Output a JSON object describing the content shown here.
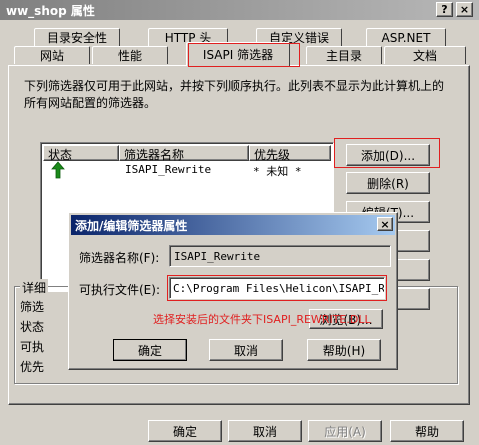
{
  "window": {
    "title": "ww_shop 属性",
    "help_glyph": "?",
    "close_glyph": "×"
  },
  "tabs_back": [
    {
      "label": "目录安全性"
    },
    {
      "label": "HTTP 头"
    },
    {
      "label": "自定义错误"
    },
    {
      "label": "ASP.NET"
    }
  ],
  "tabs_front": [
    {
      "label": "网站"
    },
    {
      "label": "性能"
    },
    {
      "label": "ISAPI 筛选器"
    },
    {
      "label": "主目录"
    },
    {
      "label": "文档"
    }
  ],
  "description": "下列筛选器仅可用于此网站，并按下列顺序执行。此列表不显示为此计算机上的所有网站配置的筛选器。",
  "filter_table": {
    "headers": [
      "状态",
      "筛选器名称",
      "优先级"
    ],
    "rows": [
      {
        "status_icon": "green-up-arrow-icon",
        "name": "ISAPI_Rewrite",
        "priority": "* 未知 *"
      }
    ]
  },
  "side_buttons": {
    "add": "添加(D)...",
    "remove": "删除(R)",
    "edit": "编辑(T)..."
  },
  "details": {
    "label": "详细",
    "rows": [
      "筛选",
      "状态",
      "可执",
      "优先"
    ]
  },
  "bottom_buttons": {
    "ok": "确定",
    "cancel": "取消",
    "apply": "应用(A)",
    "help": "帮助"
  },
  "dialog": {
    "title": "添加/编辑筛选器属性",
    "close_glyph": "×",
    "name_label": "筛选器名称(F):",
    "name_value": "ISAPI_Rewrite",
    "exe_label": "可执行文件(E):",
    "exe_value": "C:\\Program Files\\Helicon\\ISAPI_Rewr",
    "browse": "浏览(B)...",
    "annotation": "选择安装后的文件夹下ISAPI_REWRITE.DLL",
    "ok": "确定",
    "cancel": "取消",
    "help": "帮助(H)"
  },
  "colors": {
    "window_bg": "#d4d0c8",
    "dialog_title": "#0a246a",
    "annotation_red": "#e02020",
    "status_green": "#1a8a1a"
  }
}
